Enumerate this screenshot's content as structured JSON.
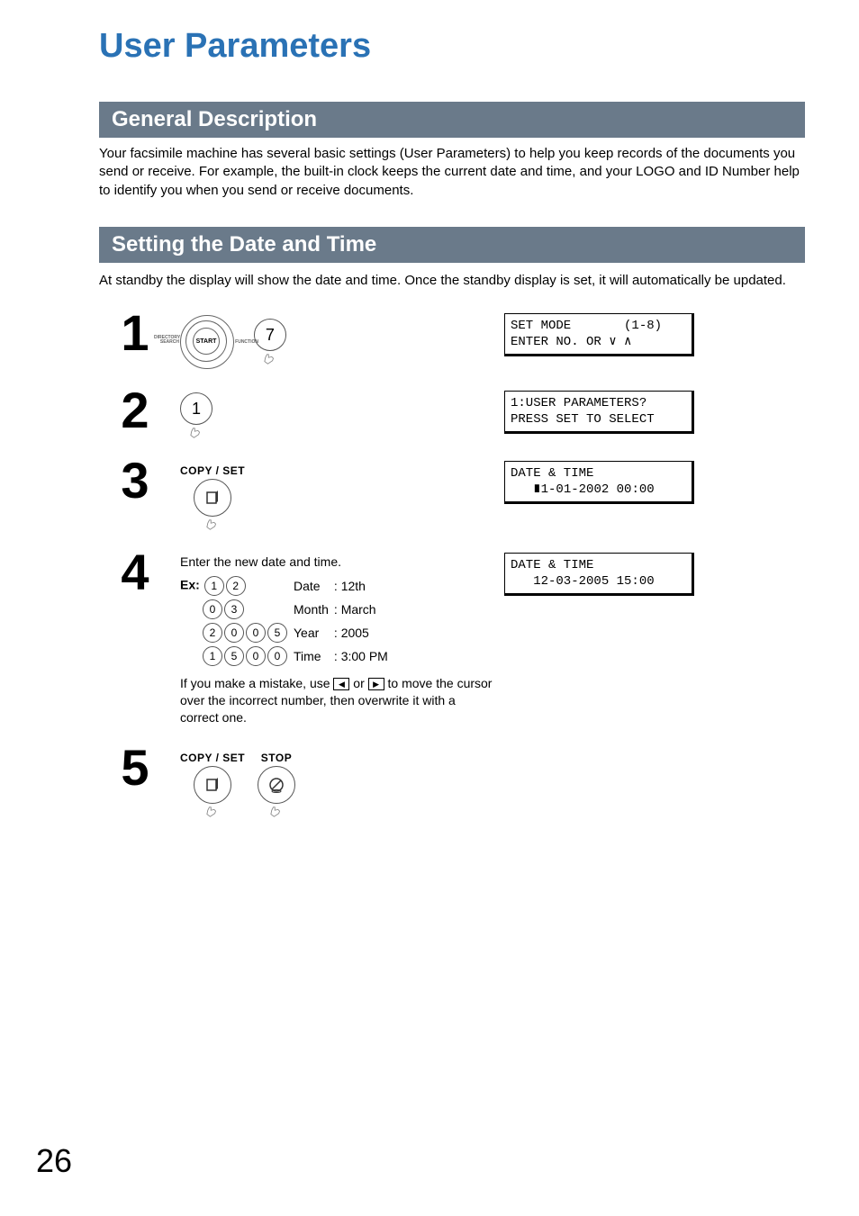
{
  "title": "User Parameters",
  "sections": {
    "general": {
      "heading": "General Description",
      "text": "Your facsimile machine has several basic settings (User Parameters) to help you keep records of the documents you send or receive. For example, the built-in clock keeps the current date and time, and your LOGO and ID Number help to identify you when you send or receive documents."
    },
    "datetime": {
      "heading": "Setting the Date and Time",
      "intro": "At standby the display will show the date and time.  Once the standby display is set, it will automatically be updated."
    }
  },
  "steps": {
    "s1": {
      "key": "7",
      "display": "SET MODE       (1-8)\nENTER NO. OR ∨ ∧",
      "dial_label_left": "DIRECTORY\nSEARCH",
      "dial_label_right": "FUNCTION",
      "dial_center": "START"
    },
    "s2": {
      "key": "1",
      "display": "1:USER PARAMETERS?\nPRESS SET TO SELECT"
    },
    "s3": {
      "copyset": "COPY / SET",
      "display": "DATE & TIME\n   ∎1-01-2002 00:00"
    },
    "s4": {
      "intro": "Enter the new date and time.",
      "ex_label": "Ex:",
      "rows": [
        {
          "keys": [
            "1",
            "2"
          ],
          "field": "Date",
          "value": ": 12th"
        },
        {
          "keys": [
            "0",
            "3"
          ],
          "field": "Month",
          "value": ": March"
        },
        {
          "keys": [
            "2",
            "0",
            "0",
            "5"
          ],
          "field": "Year",
          "value": ": 2005"
        },
        {
          "keys": [
            "1",
            "5",
            "0",
            "0"
          ],
          "field": "Time",
          "value": ": 3:00 PM"
        }
      ],
      "note_pre": "If you make a mistake, use ",
      "note_mid": " or ",
      "note_post": " to move the cursor over the incorrect number, then overwrite it with a correct one.",
      "display": "DATE & TIME\n   12-03-2005 15:00"
    },
    "s5": {
      "copyset": "COPY / SET",
      "stop": "STOP"
    }
  },
  "page_number": "26"
}
